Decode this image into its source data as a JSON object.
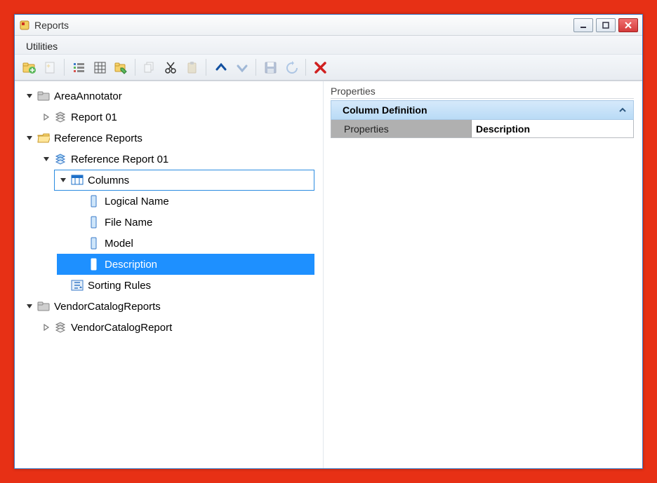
{
  "window": {
    "title": "Reports"
  },
  "menubar": {
    "utilities": "Utilities"
  },
  "toolbar": {
    "buttons": [
      {
        "name": "new-folder-button",
        "icon": "folder-plus",
        "enabled": true
      },
      {
        "name": "new-item-button",
        "icon": "sparkle-doc",
        "enabled": false
      },
      {
        "name": "sep"
      },
      {
        "name": "list-view-button",
        "icon": "list-bars",
        "enabled": true
      },
      {
        "name": "grid-view-button",
        "icon": "grid",
        "enabled": true
      },
      {
        "name": "tag-folder-button",
        "icon": "folder-tag",
        "enabled": true
      },
      {
        "name": "sep"
      },
      {
        "name": "copy-button",
        "icon": "copy",
        "enabled": false
      },
      {
        "name": "cut-button",
        "icon": "cut",
        "enabled": true
      },
      {
        "name": "paste-button",
        "icon": "paste",
        "enabled": false
      },
      {
        "name": "sep"
      },
      {
        "name": "move-up-button",
        "icon": "chev-up",
        "enabled": true
      },
      {
        "name": "move-down-button",
        "icon": "chev-down",
        "enabled": false
      },
      {
        "name": "sep"
      },
      {
        "name": "save-button",
        "icon": "save",
        "enabled": false
      },
      {
        "name": "refresh-button",
        "icon": "refresh",
        "enabled": false
      },
      {
        "name": "sep"
      },
      {
        "name": "delete-button",
        "icon": "delete-x",
        "enabled": true
      }
    ]
  },
  "tree": [
    {
      "indent": 0,
      "expander": "down-filled",
      "icon": "folder-gray",
      "label": "AreaAnnotator",
      "name": "folder-areaannotator"
    },
    {
      "indent": 1,
      "expander": "right-outline",
      "icon": "report-stack",
      "label": "Report 01",
      "name": "report-01"
    },
    {
      "indent": 0,
      "expander": "down-filled",
      "icon": "folder-open-yellow",
      "label": "Reference Reports",
      "name": "folder-reference-reports"
    },
    {
      "indent": 1,
      "expander": "down-filled",
      "icon": "report-stack-blue",
      "label": "Reference Report 01",
      "name": "reference-report-01"
    },
    {
      "indent": 2,
      "expander": "down-filled",
      "icon": "columns-grid",
      "label": "Columns",
      "name": "columns-node",
      "focused": true
    },
    {
      "indent": 3,
      "expander": "none",
      "icon": "column-item",
      "label": "Logical Name",
      "name": "column-logical-name"
    },
    {
      "indent": 3,
      "expander": "none",
      "icon": "column-item",
      "label": "File Name",
      "name": "column-file-name"
    },
    {
      "indent": 3,
      "expander": "none",
      "icon": "column-item",
      "label": "Model",
      "name": "column-model"
    },
    {
      "indent": 3,
      "expander": "none",
      "icon": "column-item-white",
      "label": "Description",
      "name": "column-description",
      "selected": true
    },
    {
      "indent": 2,
      "expander": "none",
      "icon": "sort-rules",
      "label": "Sorting Rules",
      "name": "sorting-rules"
    },
    {
      "indent": 0,
      "expander": "down-filled",
      "icon": "folder-gray",
      "label": "VendorCatalogReports",
      "name": "folder-vendorcatalogreports"
    },
    {
      "indent": 1,
      "expander": "right-outline",
      "icon": "report-stack",
      "label": "VendorCatalogReport",
      "name": "vendorcatalogreport"
    }
  ],
  "properties": {
    "section_label": "Properties",
    "header": "Column Definition",
    "rows": [
      {
        "key": "Properties",
        "value": "Description"
      }
    ]
  }
}
